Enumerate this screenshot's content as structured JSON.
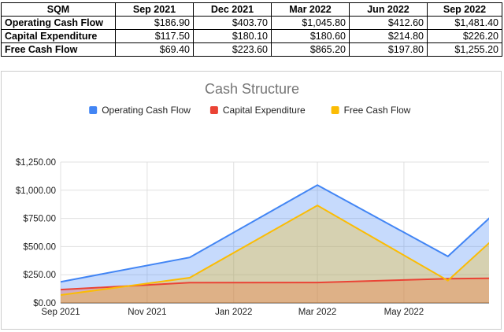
{
  "table": {
    "header": [
      "SQM",
      "Sep 2021",
      "Dec 2021",
      "Mar 2022",
      "Jun 2022",
      "Sep 2022"
    ],
    "rows": [
      {
        "label": "Operating Cash Flow",
        "values": [
          "$186.90",
          "$403.70",
          "$1,045.80",
          "$412.60",
          "$1,481.40"
        ]
      },
      {
        "label": "Capital Expenditure",
        "values": [
          "$117.50",
          "$180.10",
          "$180.60",
          "$214.80",
          "$226.20"
        ]
      },
      {
        "label": "Free Cash Flow",
        "values": [
          "$69.40",
          "$223.60",
          "$865.20",
          "$197.80",
          "$1,255.20"
        ]
      }
    ]
  },
  "chart_data": {
    "type": "area",
    "title": "Cash Structure",
    "xlabel": "",
    "ylabel": "",
    "x": [
      "2021-09-01",
      "2021-12-01",
      "2022-03-01",
      "2022-06-01",
      "2022-09-01"
    ],
    "x_range": [
      "2021-09-01",
      "2022-06-30"
    ],
    "x_ticks": [
      {
        "date": "2021-09-01",
        "label": "Sep 2021"
      },
      {
        "date": "2021-11-01",
        "label": "Nov 2021"
      },
      {
        "date": "2022-01-01",
        "label": "Jan 2022"
      },
      {
        "date": "2022-03-01",
        "label": "Mar 2022"
      },
      {
        "date": "2022-05-01",
        "label": "May 2022"
      }
    ],
    "ylim": [
      0,
      1250
    ],
    "y_ticks": [
      {
        "value": 0,
        "label": "$0.00"
      },
      {
        "value": 250,
        "label": "$250.00"
      },
      {
        "value": 500,
        "label": "$500.00"
      },
      {
        "value": 750,
        "label": "$750.00"
      },
      {
        "value": 1000,
        "label": "$1,000.00"
      },
      {
        "value": 1250,
        "label": "$1,250.00"
      }
    ],
    "grid": true,
    "legend_position": "top",
    "series": [
      {
        "name": "Operating Cash Flow",
        "color": "#4285f4",
        "values": [
          186.9,
          403.7,
          1045.8,
          412.6,
          1481.4
        ]
      },
      {
        "name": "Capital Expenditure",
        "color": "#ea4335",
        "values": [
          117.5,
          180.1,
          180.6,
          214.8,
          226.2
        ]
      },
      {
        "name": "Free Cash Flow",
        "color": "#fbbc04",
        "values": [
          69.4,
          223.6,
          865.2,
          197.8,
          1255.2
        ]
      }
    ]
  }
}
